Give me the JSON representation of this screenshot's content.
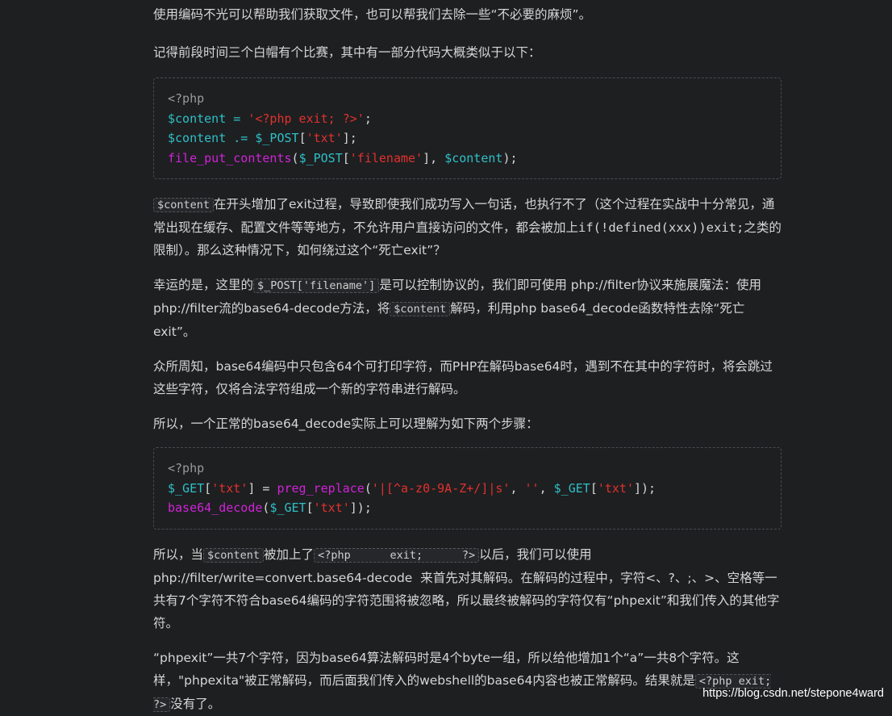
{
  "p1": "使用编码不光可以帮助我们获取文件，也可以帮我们去除一些“不必要的麻烦”。",
  "p2": "记得前段时间三个白帽有个比赛，其中有一部分代码大概类似于以下：",
  "code1": {
    "l1": "<?php",
    "l2_var": "$content",
    "l2_op": " = ",
    "l2_str": "'<?php exit; ?>'",
    "l2_end": ";",
    "l3_var": "$content",
    "l3_op": " .= ",
    "l3_var2": "$_POST",
    "l3_b1": "[",
    "l3_str": "'txt'",
    "l3_b2": "];",
    "l4_fn": "file_put_contents",
    "l4_p1": "(",
    "l4_var": "$_POST",
    "l4_b1": "[",
    "l4_str": "'filename'",
    "l4_b2": "], ",
    "l4_var2": "$content",
    "l4_end": ");"
  },
  "p3": {
    "code": "$content",
    "t1": "在开头增加了exit过程，导致即使我们成功写入一句话，也执行不了（这个过程在实战中十分常见，通常出现在缓存、配置文件等等地方，不允许用户直接访问的文件，都会被加上",
    "mono": "if(!defined(xxx))exit;",
    "t2": "之类的限制）。那么这种情况下，如何绕过这个“死亡exit”？"
  },
  "p4": {
    "t1": "幸运的是，这里的",
    "code1": "$_POST['filename']",
    "t2": "是可以控制协议的，我们即可使用  php://filter协议来施展魔法：使用php://filter流的base64-decode方法，将",
    "code2": "$content",
    "t3": "解码，利用php  base64_decode函数特性去除“死亡exit”。"
  },
  "p5": "众所周知，base64编码中只包含64个可打印字符，而PHP在解码base64时，遇到不在其中的字符时，将会跳过这些字符，仅将合法字符组成一个新的字符串进行解码。",
  "p6": "所以，一个正常的base64_decode实际上可以理解为如下两个步骤：",
  "code2": {
    "l1": "<?php",
    "l2_var": "$_GET",
    "l2_b1": "[",
    "l2_str": "'txt'",
    "l2_b2": "] = ",
    "l2_fn": "preg_replace",
    "l2_p1": "(",
    "l2_str2": "'|[^a-z0-9A-Z+/]|s'",
    "l2_c1": ", ",
    "l2_str3": "''",
    "l2_c2": ", ",
    "l2_var2": "$_GET",
    "l2_b3": "[",
    "l2_str4": "'txt'",
    "l2_end": "]);",
    "l3_fn": "base64_decode",
    "l3_p1": "(",
    "l3_var": "$_GET",
    "l3_b1": "[",
    "l3_str": "'txt'",
    "l3_end": "]);"
  },
  "p7": {
    "t1": "所以，当",
    "code1": "$content",
    "t2": "被加上了",
    "code2": "<?php      exit;      ?>",
    "t3": "以后，我们可以使用      php://filter/write=convert.base64-decode  来首先对其解码。在解码的过程中，字符<、?、;、>、空格等一共有7个字符不符合base64编码的字符范围将被忽略，所以最终被解码的字符仅有“phpexit”和我们传入的其他字符。"
  },
  "p8": {
    "t1": "“phpexit”一共7个字符，因为base64算法解码时是4个byte一组，所以给他增加1个“a”一共8个字符。这样，\"phpexita\"被正常解码，而后面我们传入的webshell的base64内容也被正常解码。结果就是",
    "code": "<?php exit; ?>",
    "t2": "没有了。"
  },
  "watermark": "https://blog.csdn.net/stepone4ward"
}
